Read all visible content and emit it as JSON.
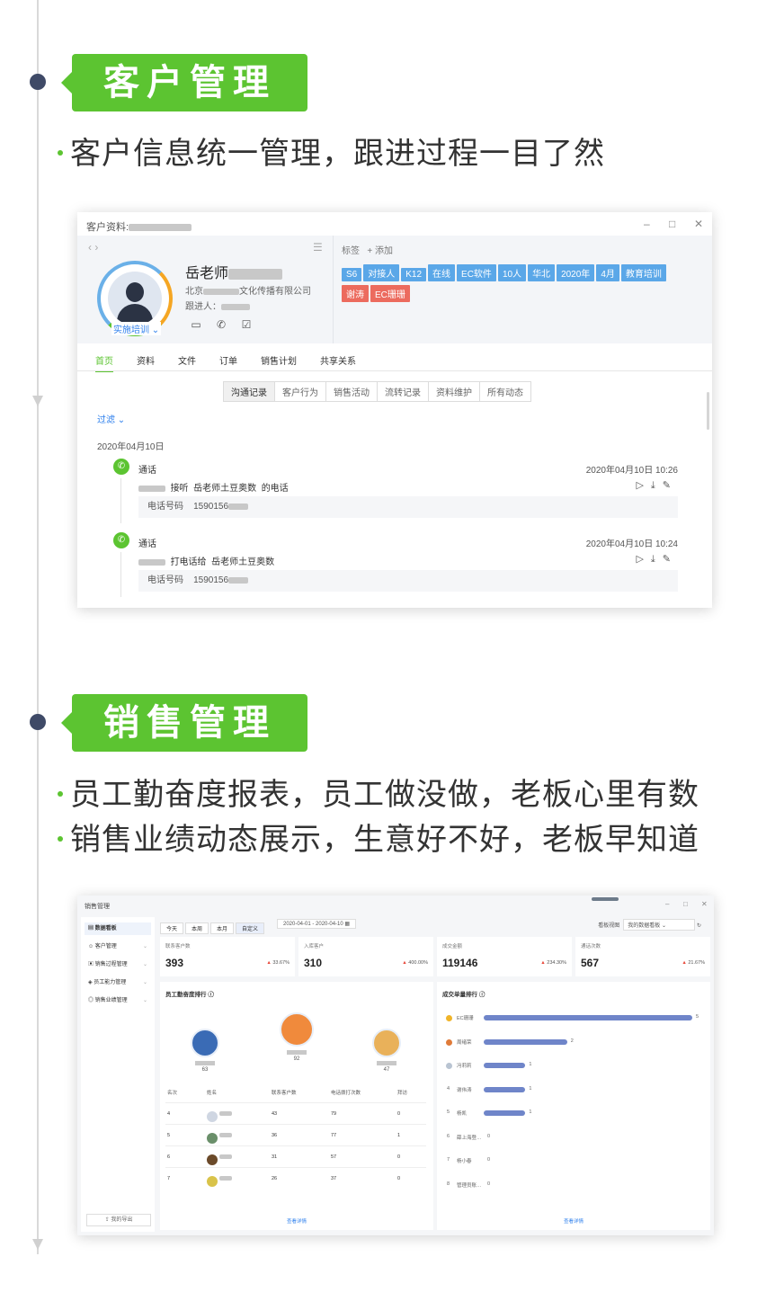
{
  "section1": {
    "title": "客户管理",
    "bullets": [
      "客户信息统一管理，跟进过程一目了然"
    ]
  },
  "customer_window": {
    "title": "客户资料:",
    "min_icon": "minimize-icon",
    "max_icon": "maximize-icon",
    "close_icon": "close-icon",
    "nav_arrows": "‹ ›",
    "menu_glyph": "☰",
    "name": "岳老师",
    "company_prefix": "北京",
    "company_suffix": "文化传播有限公司",
    "follow_label": "跟进人：",
    "stage": "实施培训",
    "tag_label": "标签",
    "add_tag": "+ 添加",
    "tags_blue": [
      "S6",
      "对接人",
      "K12",
      "在线",
      "EC软件",
      "10人",
      "华北",
      "2020年",
      "4月",
      "教育培训"
    ],
    "tags_red": [
      "谢涛",
      "EC珊珊"
    ],
    "tabs": [
      "首页",
      "资料",
      "文件",
      "订单",
      "销售计划",
      "共享关系"
    ],
    "subtabs": [
      "沟通记录",
      "客户行为",
      "销售活动",
      "流转记录",
      "资料维护",
      "所有动态"
    ],
    "filter": "过滤",
    "date": "2020年04月10日",
    "records": [
      {
        "kind": "通话",
        "time": "2020年04月10日 10:26",
        "action": "接听",
        "contact": "岳老师土豆奥数",
        "tail": "的电话",
        "phone_label": "电话号码",
        "phone": "1590156"
      },
      {
        "kind": "通话",
        "time": "2020年04月10日 10:24",
        "action": "打电话给",
        "contact": "岳老师土豆奥数",
        "tail": "",
        "phone_label": "电话号码",
        "phone": "1590156"
      }
    ]
  },
  "section2": {
    "title": "销售管理",
    "bullets": [
      "员工勤奋度报表，员工做没做，老板心里有数",
      "销售业绩动态展示，生意好不好，老板早知道"
    ]
  },
  "sales_window": {
    "title": "销售管理",
    "sidebar": [
      "数据看板",
      "客户管理",
      "销售过程管理",
      "员工能力管理",
      "销售业绩管理"
    ],
    "export": "我的导出",
    "periods": [
      "今天",
      "本周",
      "本月",
      "自定义"
    ],
    "date_range": "2020-04-01  -  2020-04-10",
    "board_label": "看板视图",
    "board_value": "我的数据看板",
    "kpis": [
      {
        "label": "联系客户数",
        "value": "393",
        "change": "33.67%"
      },
      {
        "label": "入库客户",
        "value": "310",
        "change": "400.00%"
      },
      {
        "label": "成交金额",
        "value": "119146",
        "change": "234.30%"
      },
      {
        "label": "通话次数",
        "value": "567",
        "change": "21.67%"
      }
    ],
    "left_panel": {
      "title": "员工勤奋度排行",
      "podium": [
        {
          "rank": "2",
          "score": "63"
        },
        {
          "rank": "1",
          "score": "92"
        },
        {
          "rank": "3",
          "score": "47"
        }
      ],
      "headers": [
        "名次",
        "姓名",
        "联系客户数",
        "电话拨打次数",
        "拜访"
      ],
      "rows": [
        {
          "rank": "4",
          "contacts": "43",
          "calls": "79",
          "visits": "0"
        },
        {
          "rank": "5",
          "contacts": "36",
          "calls": "77",
          "visits": "1"
        },
        {
          "rank": "6",
          "contacts": "31",
          "calls": "57",
          "visits": "0"
        },
        {
          "rank": "7",
          "contacts": "26",
          "calls": "37",
          "visits": "0"
        }
      ],
      "more": "查看详情"
    },
    "right_panel": {
      "title": "成交单量排行",
      "bars": [
        {
          "rank": "1",
          "name": "EC珊珊",
          "value": 5
        },
        {
          "rank": "2",
          "name": "周绪荣",
          "value": 2
        },
        {
          "rank": "3",
          "name": "冯莉莉",
          "value": 1
        },
        {
          "rank": "4",
          "name": "谢伟涛",
          "value": 1
        },
        {
          "rank": "5",
          "name": "杨凯",
          "value": 1
        },
        {
          "rank": "6",
          "name": "薛上海登…",
          "value": 0
        },
        {
          "rank": "7",
          "name": "杨小春",
          "value": 0
        },
        {
          "rank": "8",
          "name": "管理员账…",
          "value": 0
        }
      ],
      "more": "查看详情"
    }
  }
}
